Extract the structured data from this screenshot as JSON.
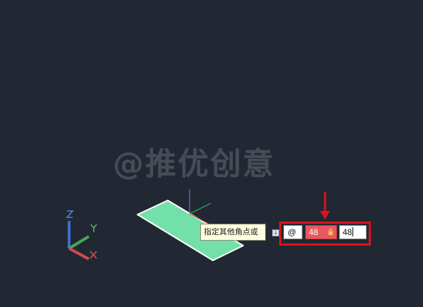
{
  "watermark": {
    "text": "@推优创意"
  },
  "prompt": {
    "tooltip": "指定其他角点或"
  },
  "dynamic_input": {
    "relative_symbol": "@",
    "x_value": "48",
    "y_value": "48"
  },
  "ucs_icon": {
    "z_label": "Z",
    "y_label": "Y",
    "x_label": "X"
  },
  "colors": {
    "background": "#222833",
    "rectangle_fill": "#72e0a8",
    "highlight": "#d8151b",
    "x_field": "#e8595f"
  },
  "icons": [
    "command-tool-icon",
    "lock-icon",
    "crosshair-cursor-icon",
    "ucs-axis-icon",
    "red-arrow-icon"
  ]
}
